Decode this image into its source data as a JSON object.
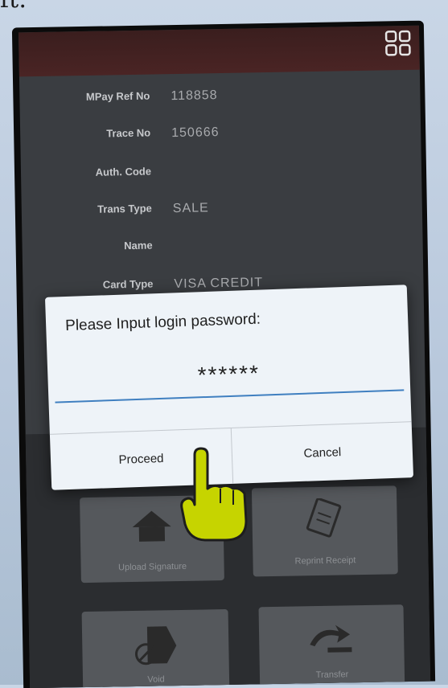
{
  "page_edge_text": "ſt:",
  "header": {
    "apps_icon": "grid-apps-icon"
  },
  "details": [
    {
      "label": "MPay Ref No",
      "value": "118858"
    },
    {
      "label": "Trace No",
      "value": "150666"
    },
    {
      "label": "Auth. Code",
      "value": ""
    },
    {
      "label": "Trans Type",
      "value": "SALE"
    },
    {
      "label": "Name",
      "value": ""
    },
    {
      "label": "Card Type",
      "value": "VISA CREDIT"
    }
  ],
  "tiles": [
    {
      "label": "Upload Signature",
      "icon": "upload-icon"
    },
    {
      "label": "Reprint Receipt",
      "icon": "receipt-icon"
    },
    {
      "label": "Void",
      "icon": "void-tag-icon"
    },
    {
      "label": "Transfer",
      "icon": "transfer-icon"
    }
  ],
  "dialog": {
    "title": "Please Input login password:",
    "password_masked": "******",
    "proceed_label": "Proceed",
    "cancel_label": "Cancel"
  },
  "colors": {
    "topbar": "#4a2424",
    "dialog_bg": "#eef3f8",
    "input_underline": "#3f7fc0",
    "hand": "#c6d400"
  }
}
